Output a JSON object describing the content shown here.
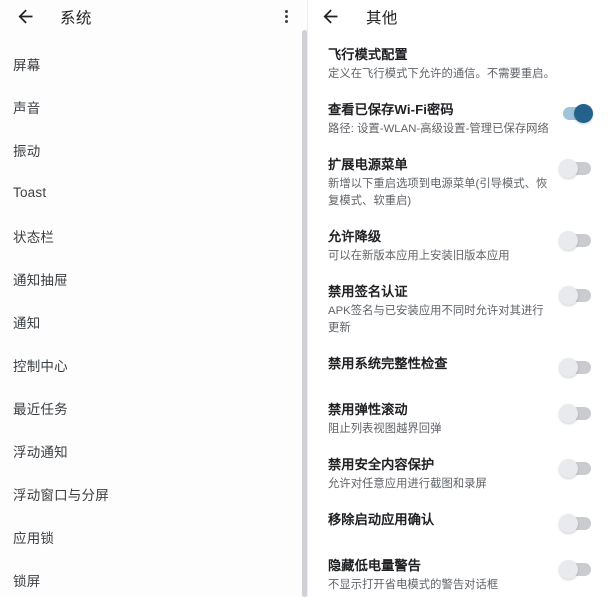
{
  "theme": {
    "background": "#ffffff",
    "sidebar_background": "#fdfdfe",
    "title_color": "#202124",
    "subtitle_color": "#5f6368",
    "toggle_on_track": "#9fc3d8",
    "toggle_on_thumb": "#25628b",
    "toggle_off_track": "#c9cbcf",
    "toggle_off_thumb": "#e8eaed",
    "scrollbar_color": "#cfd1d6"
  },
  "left_panel": {
    "back_label": "back-arrow",
    "title": "系统",
    "overflow_label": "more-options",
    "items": [
      {
        "label": "屏幕"
      },
      {
        "label": "声音"
      },
      {
        "label": "振动"
      },
      {
        "label": "Toast"
      },
      {
        "label": "状态栏"
      },
      {
        "label": "通知抽屉"
      },
      {
        "label": "通知"
      },
      {
        "label": "控制中心"
      },
      {
        "label": "最近任务"
      },
      {
        "label": "浮动通知"
      },
      {
        "label": "浮动窗口与分屏"
      },
      {
        "label": "应用锁"
      },
      {
        "label": "锁屏"
      }
    ]
  },
  "right_panel": {
    "back_label": "back-arrow",
    "title": "其他",
    "settings": [
      {
        "title": "飞行模式配置",
        "subtitle": "定义在飞行模式下允许的通信。不需要重启。",
        "has_toggle": false,
        "enabled": false
      },
      {
        "title": "查看已保存Wi-Fi密码",
        "subtitle": "路径: 设置-WLAN-高级设置-管理已保存网络",
        "has_toggle": true,
        "enabled": true
      },
      {
        "title": "扩展电源菜单",
        "subtitle": "新增以下重启选项到电源菜单(引导模式、恢复模式、软重启)",
        "has_toggle": true,
        "enabled": false
      },
      {
        "title": "允许降级",
        "subtitle": "可以在新版本应用上安装旧版本应用",
        "has_toggle": true,
        "enabled": false
      },
      {
        "title": "禁用签名认证",
        "subtitle": "APK签名与已安装应用不同时允许对其进行更新",
        "has_toggle": true,
        "enabled": false
      },
      {
        "title": "禁用系统完整性检查",
        "subtitle": "",
        "has_toggle": true,
        "enabled": false
      },
      {
        "title": "禁用弹性滚动",
        "subtitle": "阻止列表视图越界回弹",
        "has_toggle": true,
        "enabled": false
      },
      {
        "title": "禁用安全内容保护",
        "subtitle": "允许对任意应用进行截图和录屏",
        "has_toggle": true,
        "enabled": false
      },
      {
        "title": "移除启动应用确认",
        "subtitle": "",
        "has_toggle": true,
        "enabled": false
      },
      {
        "title": "隐藏低电量警告",
        "subtitle": "不显示打开省电模式的警告对话框",
        "has_toggle": true,
        "enabled": false
      }
    ]
  }
}
